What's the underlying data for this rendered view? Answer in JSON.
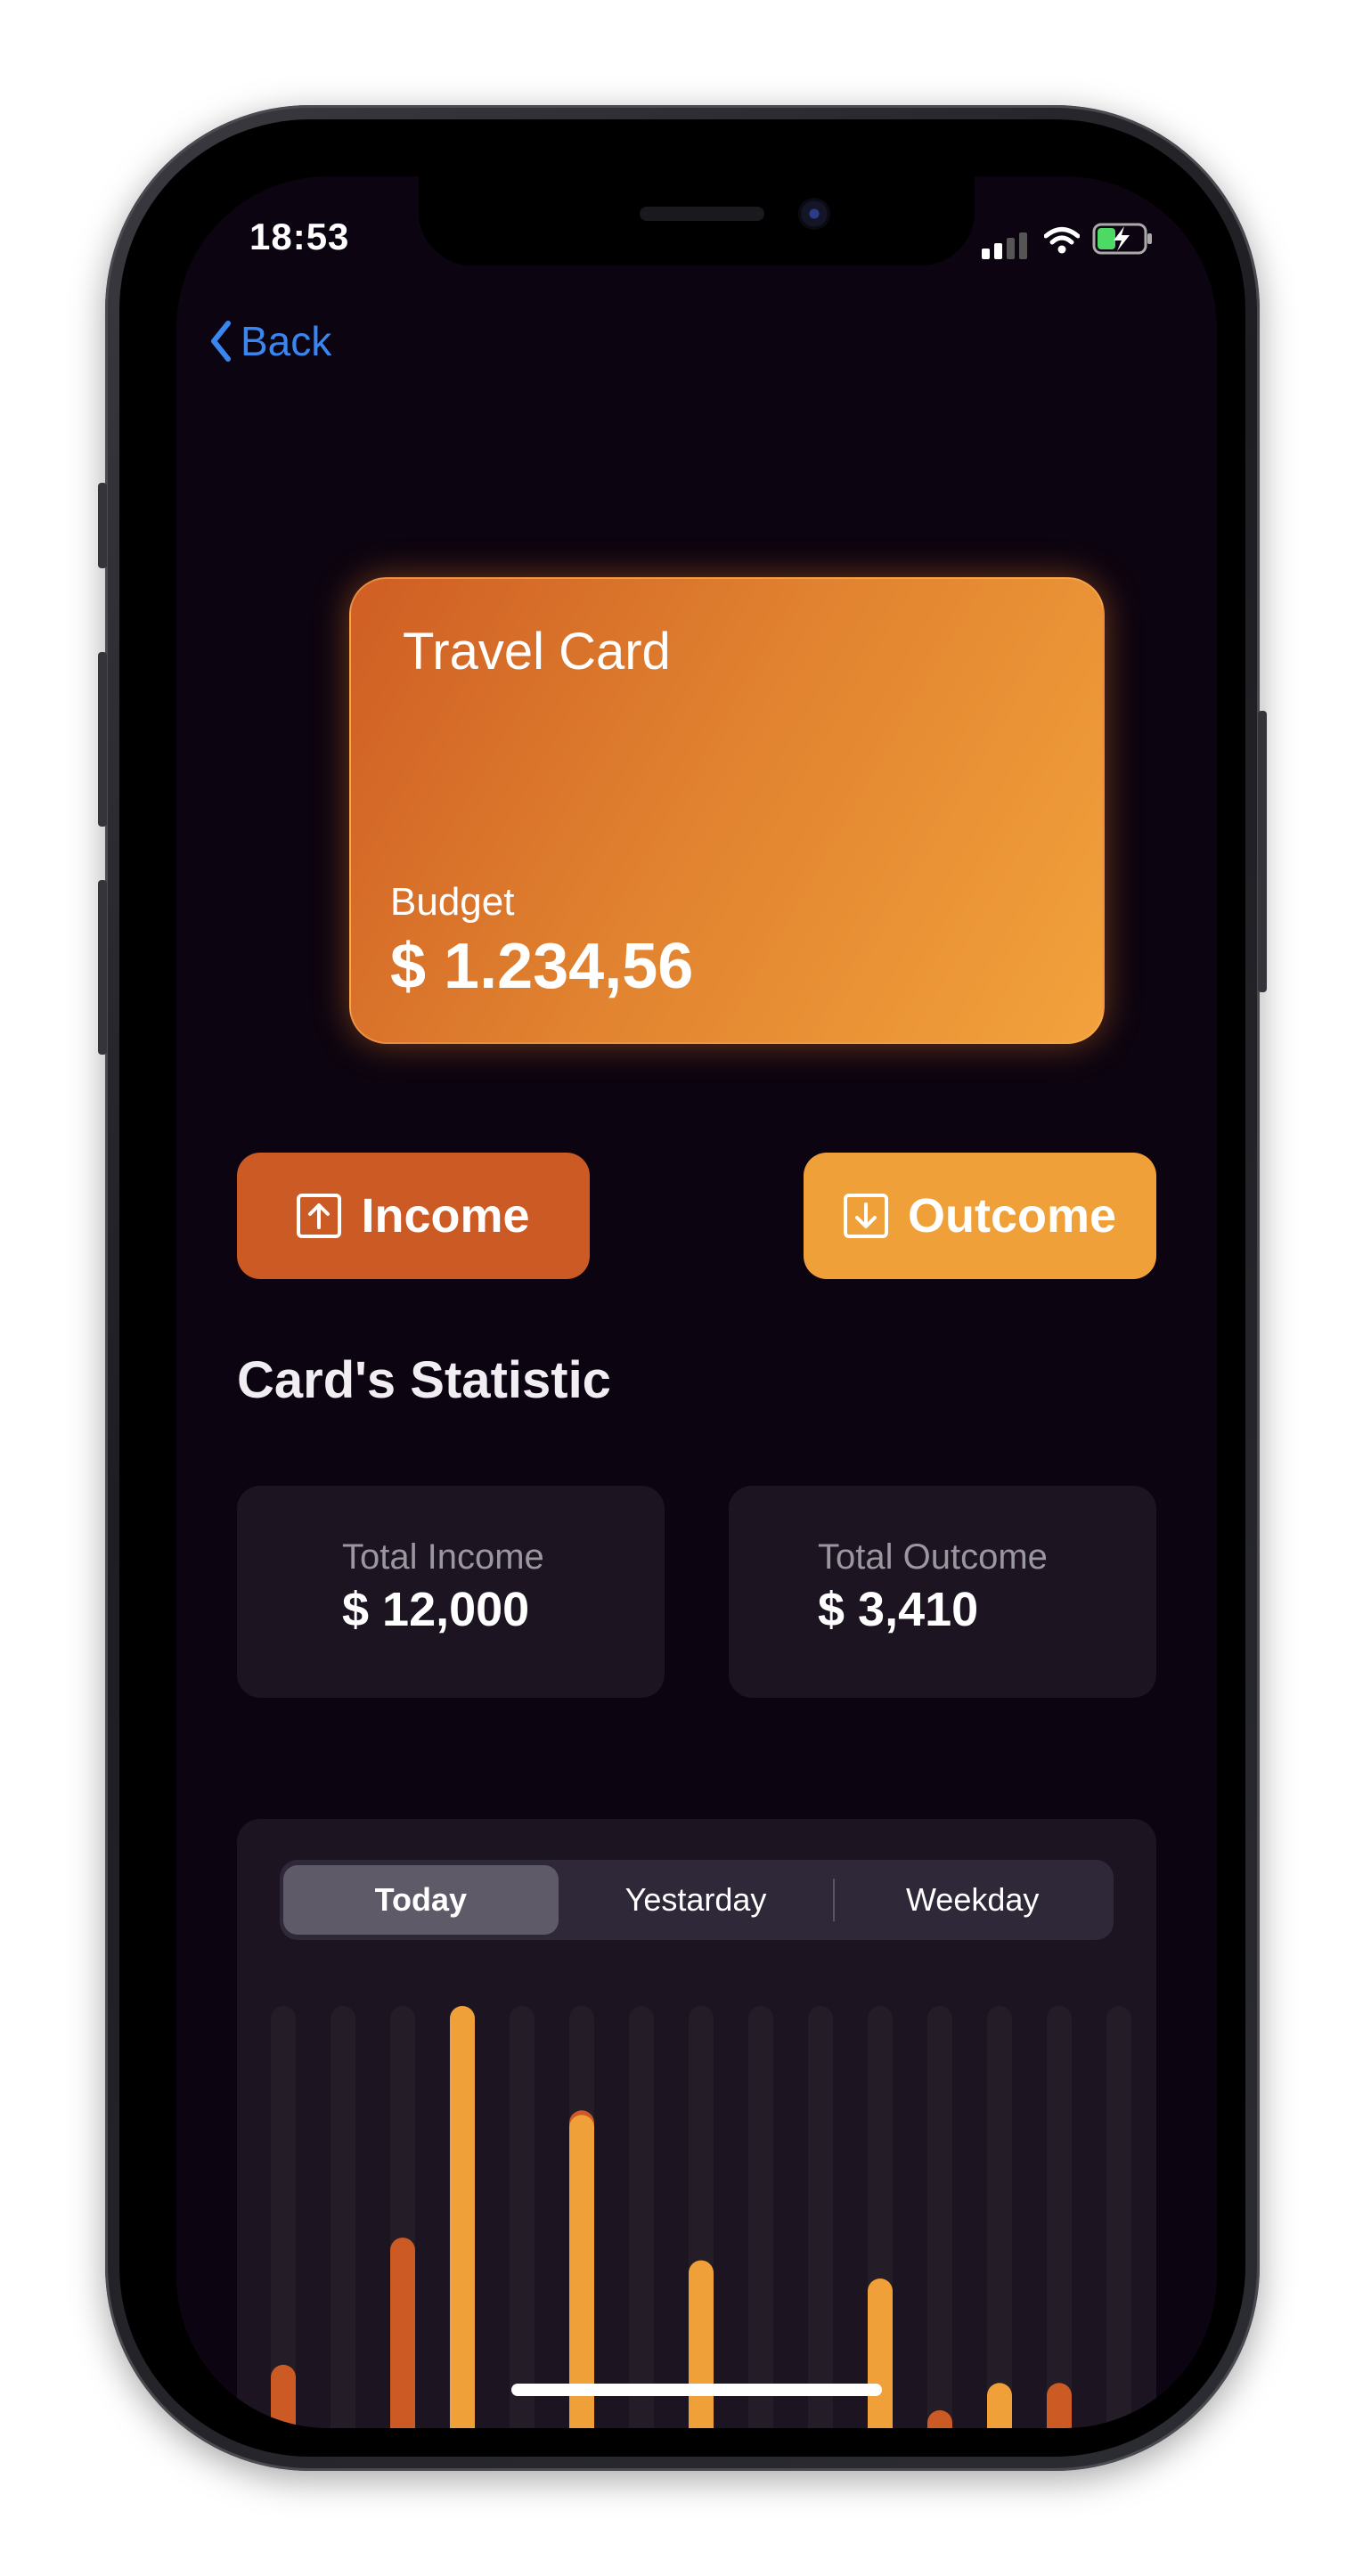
{
  "status_bar": {
    "time": "18:53"
  },
  "nav": {
    "back_label": "Back"
  },
  "card": {
    "title": "Travel Card",
    "budget_label": "Budget",
    "budget_value": "$ 1.234,56"
  },
  "actions": {
    "income_label": "Income",
    "outcome_label": "Outcome"
  },
  "statistics": {
    "title": "Card's Statistic",
    "total_income_label": "Total Income",
    "total_income_value": "$ 12,000",
    "total_outcome_label": "Total Outcome",
    "total_outcome_value": "$ 3,410"
  },
  "periods": {
    "tabs": [
      "Today",
      "Yestarday",
      "Weekday"
    ],
    "selected": "Today"
  },
  "colors": {
    "income": "#cc5a24",
    "outcome": "#f0a038",
    "background": "#0c0410",
    "link": "#3a86f0"
  },
  "chart_data": {
    "type": "bar",
    "series": [
      {
        "name": "",
        "color": "#cc5a24",
        "values": [
          0.21,
          0,
          0.49,
          0,
          0,
          0.77,
          0,
          0,
          0,
          0.04,
          0,
          0.11,
          0,
          0.17,
          0
        ]
      },
      {
        "name": "",
        "color": "#f0a038",
        "values": [
          0,
          0,
          0,
          1.0,
          0,
          0.76,
          0,
          0.44,
          0,
          0,
          0.4,
          0,
          0.17,
          0,
          0.02
        ]
      }
    ],
    "grid": true
  }
}
